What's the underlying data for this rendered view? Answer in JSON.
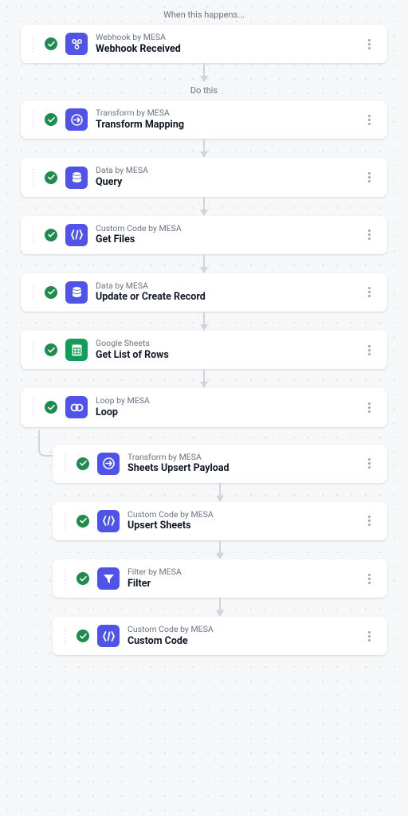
{
  "labels": {
    "when": "When this happens...",
    "do": "Do this"
  },
  "trigger": {
    "app": "Webhook by MESA",
    "title": "Webhook Received",
    "icon": "webhook"
  },
  "steps": [
    {
      "app": "Transform by MESA",
      "title": "Transform Mapping",
      "icon": "transform"
    },
    {
      "app": "Data by MESA",
      "title": "Query",
      "icon": "data"
    },
    {
      "app": "Custom Code by MESA",
      "title": "Get Files",
      "icon": "code"
    },
    {
      "app": "Data by MESA",
      "title": "Update or Create Record",
      "icon": "data"
    },
    {
      "app": "Google Sheets",
      "title": "Get List of Rows",
      "icon": "sheets"
    },
    {
      "app": "Loop by MESA",
      "title": "Loop",
      "icon": "loop"
    }
  ],
  "loopSteps": [
    {
      "app": "Transform by MESA",
      "title": "Sheets Upsert Payload",
      "icon": "transform"
    },
    {
      "app": "Custom Code by MESA",
      "title": "Upsert Sheets",
      "icon": "code"
    },
    {
      "app": "Filter by MESA",
      "title": "Filter",
      "icon": "filter"
    },
    {
      "app": "Custom Code by MESA",
      "title": "Custom Code",
      "icon": "code"
    }
  ]
}
